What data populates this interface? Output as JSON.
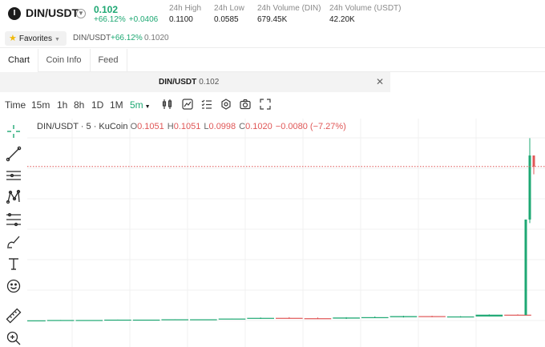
{
  "ticker": {
    "logo_letter": "I",
    "pair": "DIN/USDT",
    "price": "0.102",
    "change_pct": "+66.12%",
    "change_abs": "+0.0406",
    "stats": [
      {
        "label": "24h High",
        "value": "0.1100"
      },
      {
        "label": "24h Low",
        "value": "0.0585"
      },
      {
        "label": "24h Volume (DIN)",
        "value": "679.45K"
      },
      {
        "label": "24h Volume (USDT)",
        "value": "42.20K"
      }
    ]
  },
  "favorites": {
    "label": "Favorites",
    "pair": "DIN/USDT",
    "change": "+66.12%",
    "price": "0.1020"
  },
  "tabs": [
    "Chart",
    "Coin Info",
    "Feed"
  ],
  "active_tab": "Chart",
  "chart_title": {
    "pair": "DIN/USDT",
    "price": "0.102"
  },
  "toolbar": {
    "time_label": "Time",
    "intervals": [
      "15m",
      "1h",
      "8h",
      "1D",
      "1M"
    ],
    "active_interval": "5m",
    "icons": [
      "indicators-icon",
      "chart-type-icon",
      "settings-list-icon",
      "gear-icon",
      "camera-icon",
      "fullscreen-icon"
    ]
  },
  "draw_tools": [
    "crosshair-icon",
    "trend-line-icon",
    "horizontal-lines-icon",
    "pattern-icon",
    "fib-icon",
    "brush-icon",
    "text-icon",
    "emoji-icon",
    "ruler-icon",
    "zoom-in-icon"
  ],
  "legend": {
    "symbol": "DIN/USDT · 5 · KuCoin",
    "open_label": "O",
    "open": "0.1051",
    "high_label": "H",
    "high": "0.1051",
    "low_label": "L",
    "low": "0.0998",
    "close_label": "C",
    "close": "0.1020",
    "change": "−0.0080 (−7.27%)"
  },
  "colors": {
    "up": "#1ea873",
    "down": "#e05757",
    "accent": "#1ea873"
  },
  "chart_data": {
    "type": "candlestick",
    "ylim": [
      0.0,
      0.11
    ],
    "last_price": 0.102,
    "candles": [
      {
        "o": 0.0585,
        "h": 0.0585,
        "l": 0.0585,
        "c": 0.0585
      },
      {
        "o": 0.0585,
        "h": 0.0586,
        "l": 0.0585,
        "c": 0.0586
      },
      {
        "o": 0.0586,
        "h": 0.0586,
        "l": 0.0586,
        "c": 0.0586
      },
      {
        "o": 0.0586,
        "h": 0.0587,
        "l": 0.0586,
        "c": 0.0587
      },
      {
        "o": 0.0587,
        "h": 0.0587,
        "l": 0.0587,
        "c": 0.0587
      },
      {
        "o": 0.0587,
        "h": 0.0588,
        "l": 0.0587,
        "c": 0.0588
      },
      {
        "o": 0.0588,
        "h": 0.0588,
        "l": 0.0588,
        "c": 0.0588
      },
      {
        "o": 0.0588,
        "h": 0.059,
        "l": 0.0588,
        "c": 0.059
      },
      {
        "o": 0.059,
        "h": 0.0593,
        "l": 0.0589,
        "c": 0.0592
      },
      {
        "o": 0.0592,
        "h": 0.0594,
        "l": 0.059,
        "c": 0.0591
      },
      {
        "o": 0.0591,
        "h": 0.0593,
        "l": 0.0589,
        "c": 0.059
      },
      {
        "o": 0.059,
        "h": 0.0594,
        "l": 0.0589,
        "c": 0.0593
      },
      {
        "o": 0.0593,
        "h": 0.0596,
        "l": 0.0592,
        "c": 0.0594
      },
      {
        "o": 0.0594,
        "h": 0.0598,
        "l": 0.0593,
        "c": 0.0597
      },
      {
        "o": 0.0597,
        "h": 0.0598,
        "l": 0.0594,
        "c": 0.0595
      },
      {
        "o": 0.0595,
        "h": 0.0597,
        "l": 0.0593,
        "c": 0.0596
      },
      {
        "o": 0.0596,
        "h": 0.0602,
        "l": 0.0596,
        "c": 0.0601
      },
      {
        "o": 0.0601,
        "h": 0.0602,
        "l": 0.0599,
        "c": 0.06
      },
      {
        "o": 0.06,
        "h": 0.087,
        "l": 0.06,
        "c": 0.087
      },
      {
        "o": 0.087,
        "h": 0.11,
        "l": 0.086,
        "c": 0.1051
      },
      {
        "o": 0.1051,
        "h": 0.1051,
        "l": 0.0998,
        "c": 0.102
      }
    ]
  }
}
